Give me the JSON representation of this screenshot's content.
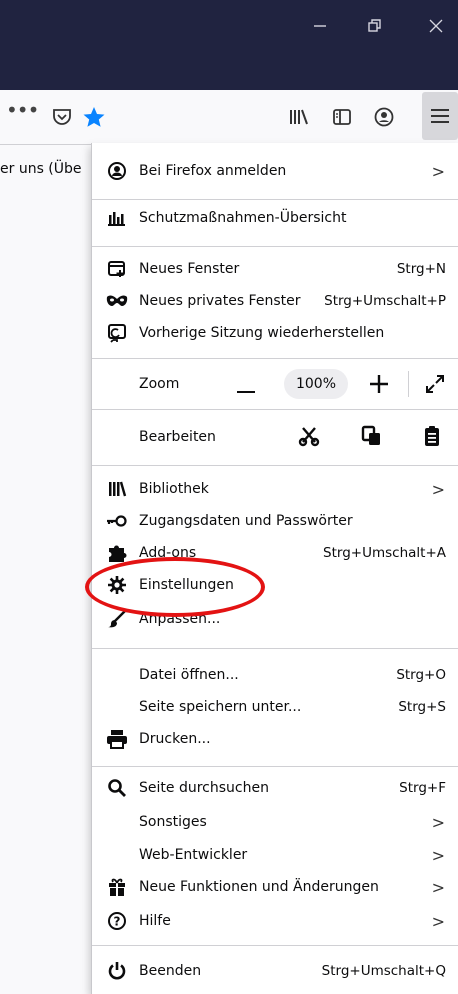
{
  "window": {
    "controls": [
      {
        "name": "minimize-icon"
      },
      {
        "name": "restore-icon"
      },
      {
        "name": "close-icon"
      }
    ]
  },
  "toolbar": {
    "overflow_glyph": "•••",
    "icons": [
      "pocket-icon",
      "star-icon",
      "library-icon",
      "sidebar-icon",
      "account-icon",
      "hamburger-menu-icon"
    ],
    "star_color": "#0a84ff"
  },
  "bookmarks": {
    "partial_text": "er uns (Übe"
  },
  "menu": {
    "sign_in": "Bei Firefox anmelden",
    "protections": "Schutzmaßnahmen-Übersicht",
    "new_window": "Neues Fenster",
    "new_window_shortcut": "Strg+N",
    "private_window": "Neues privates Fenster",
    "private_window_shortcut": "Strg+Umschalt+P",
    "restore_session": "Vorherige Sitzung wiederherstellen",
    "zoom_label": "Zoom",
    "zoom_value": "100%",
    "edit_label": "Bearbeiten",
    "library": "Bibliothek",
    "logins": "Zugangsdaten und Passwörter",
    "addons": "Add-ons",
    "addons_shortcut": "Strg+Umschalt+A",
    "settings": "Einstellungen",
    "customize": "Anpassen...",
    "open_file": "Datei öffnen...",
    "open_file_shortcut": "Strg+O",
    "save_page": "Seite speichern unter...",
    "save_page_shortcut": "Strg+S",
    "print": "Drucken...",
    "find": "Seite durchsuchen",
    "find_shortcut": "Strg+F",
    "more": "Sonstiges",
    "web_dev": "Web-Entwickler",
    "whats_new": "Neue Funktionen und Änderungen",
    "help": "Hilfe",
    "quit": "Beenden",
    "quit_shortcut": "Strg+Umschalt+Q"
  },
  "annotation": {
    "highlight_color": "#e31313"
  }
}
